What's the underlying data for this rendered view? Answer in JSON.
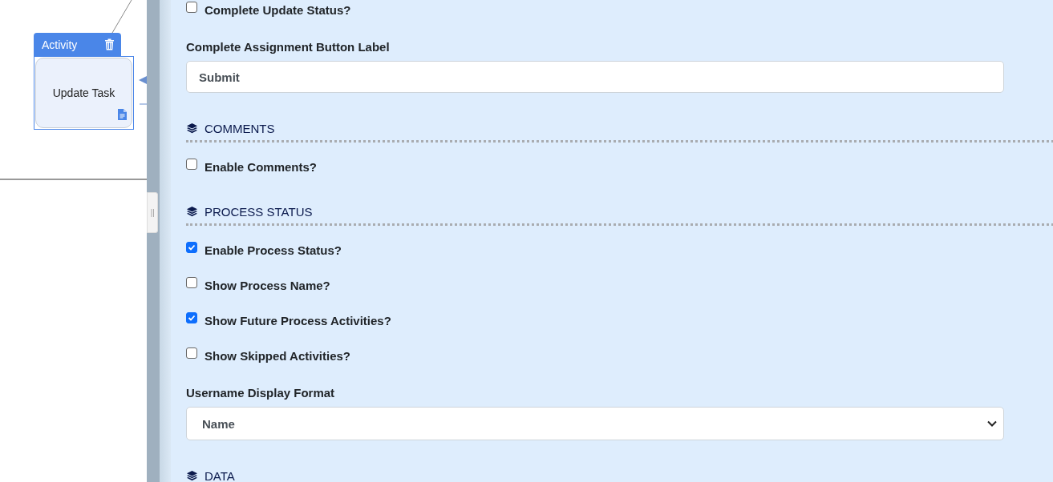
{
  "diagram": {
    "node": {
      "header": "Activity",
      "label": "Update Task",
      "selected": true
    }
  },
  "form": [
    {
      "kind": "checkbox",
      "label": "Complete Update Status?",
      "checked": false
    },
    {
      "kind": "text",
      "label": "Complete Assignment Button Label",
      "value": "Submit"
    },
    {
      "kind": "section",
      "title": "COMMENTS"
    },
    {
      "kind": "checkbox",
      "label": "Enable Comments?",
      "checked": false
    },
    {
      "kind": "section",
      "title": "PROCESS STATUS"
    },
    {
      "kind": "checkbox",
      "label": "Enable Process Status?",
      "checked": true
    },
    {
      "kind": "checkbox",
      "label": "Show Process Name?",
      "checked": false
    },
    {
      "kind": "checkbox",
      "label": "Show Future Process Activities?",
      "checked": true
    },
    {
      "kind": "checkbox",
      "label": "Show Skipped Activities?",
      "checked": false
    },
    {
      "kind": "select",
      "label": "Username Display Format",
      "value": "Name"
    },
    {
      "kind": "section",
      "title": "DATA"
    }
  ]
}
